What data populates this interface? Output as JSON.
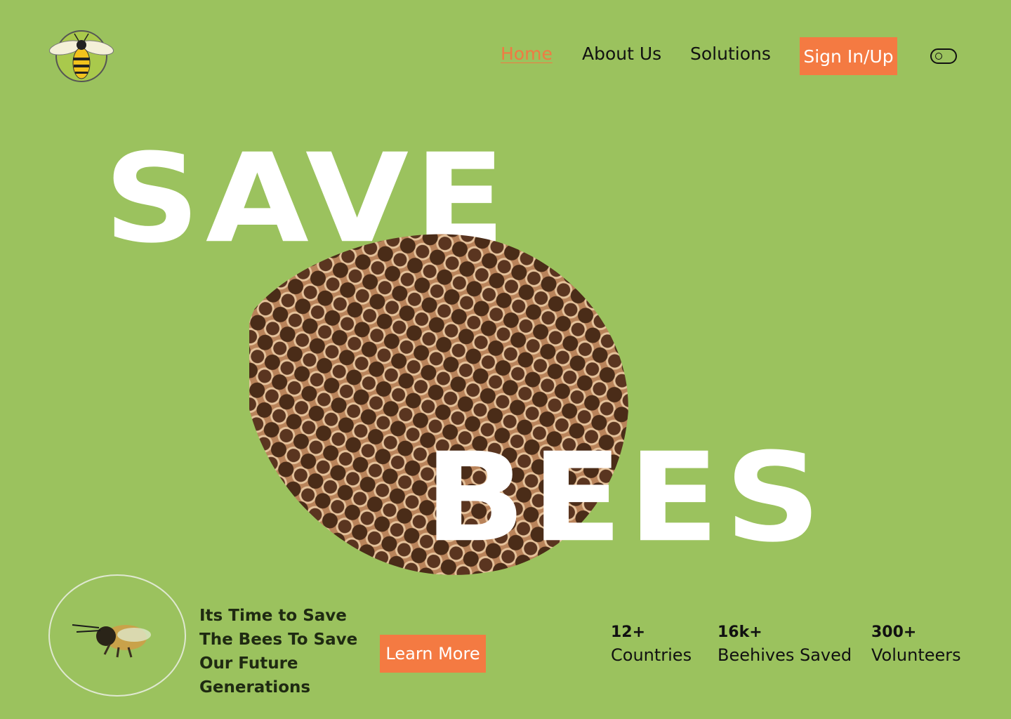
{
  "nav": {
    "home": "Home",
    "about": "About Us",
    "solutions": "Solutions",
    "sign_in": "Sign In/Up",
    "theme_toggle_icon": "toggle-icon"
  },
  "hero": {
    "word1": "SAVE",
    "word2": "BEES",
    "tagline": "Its Time to Save The Bees To Save Our Future Generations",
    "learn_more": "Learn More"
  },
  "stats": [
    {
      "value": "12+",
      "label": "Countries"
    },
    {
      "value": "16k+",
      "label": "Beehives Saved"
    },
    {
      "value": "300+",
      "label": "Volunteers"
    }
  ],
  "colors": {
    "background": "#9bc25e",
    "accent": "#f47a42",
    "hero_text": "#ffffff"
  }
}
